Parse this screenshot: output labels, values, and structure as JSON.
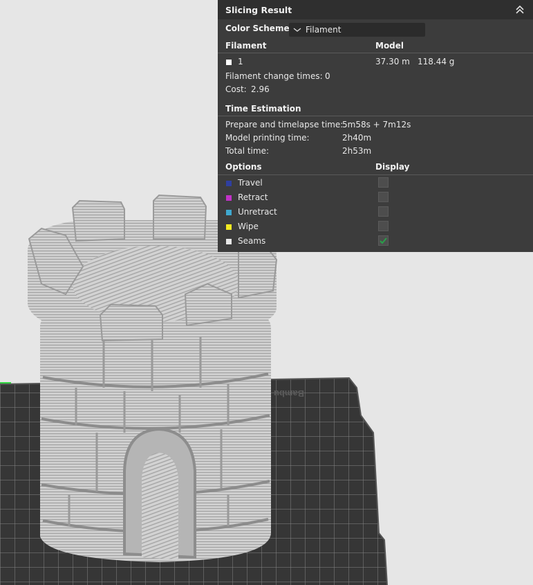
{
  "panel": {
    "title": "Slicing Result",
    "color_scheme_label": "Color Scheme",
    "color_scheme_value": "Filament",
    "filament_header": "Filament",
    "model_header": "Model",
    "filament_index": "1",
    "filament_length": "37.30 m",
    "filament_weight": "118.44 g",
    "filament_change_label": "Filament change times:",
    "filament_change_value": "0",
    "cost_label": "Cost:",
    "cost_value": "2.96",
    "time_header": "Time Estimation",
    "prepare_label": "Prepare and timelapse time:",
    "prepare_value": "5m58s + 7m12s",
    "model_time_label": "Model printing time:",
    "model_time_value": "2h40m",
    "total_label": "Total time:",
    "total_value": "2h53m",
    "options_header": "Options",
    "display_header": "Display",
    "options": [
      {
        "label": "Travel",
        "color": "#2f3fa0",
        "checked": false
      },
      {
        "label": "Retract",
        "color": "#c232c8",
        "checked": false
      },
      {
        "label": "Unretract",
        "color": "#3fa8cf",
        "checked": false
      },
      {
        "label": "Wipe",
        "color": "#f2ea22",
        "checked": false
      },
      {
        "label": "Seams",
        "color": "#e8e8e8",
        "checked": true
      }
    ]
  },
  "plate_text": "Bambu Te",
  "colors": {
    "panel_bg": "#3c3c3c",
    "plate": "#3a3a3a",
    "model": "#c8c8c8",
    "check_green": "#29a14a"
  }
}
